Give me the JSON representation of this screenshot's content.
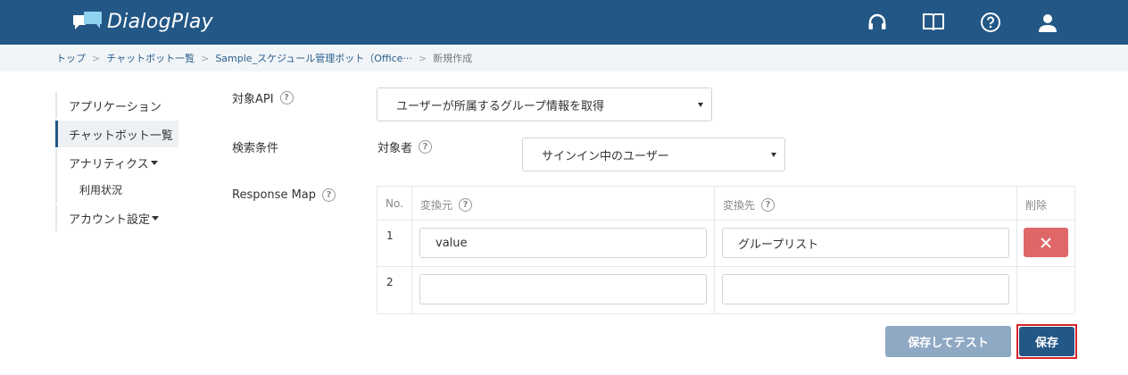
{
  "app": {
    "title": "DialogPlay"
  },
  "header": {
    "icons": [
      "headset-icon",
      "book-icon",
      "help-icon",
      "user-icon"
    ]
  },
  "breadcrumb": {
    "items": [
      "トップ",
      "チャットボット一覧",
      "Sample_スケジュール管理ボット（Office···"
    ],
    "current": "新規作成"
  },
  "sidenav": {
    "application": "アプリケーション",
    "chatbot_list": "チャットボット一覧",
    "analytics": "アナリティクス",
    "usage": "利用状況",
    "account": "アカウント設定"
  },
  "form": {
    "target_api_label": "対象API",
    "target_api_value": "ユーザーが所属するグループ情報を取得",
    "search_cond_label": "検索条件",
    "target_person_label": "対象者",
    "target_person_value": "サインイン中のユーザー",
    "response_map_label": "Response Map"
  },
  "response_table": {
    "headers": {
      "no": "No.",
      "from": "変換元",
      "to": "変換先",
      "delete": "削除"
    },
    "rows": [
      {
        "no": "1",
        "from": "value",
        "to": "グループリスト"
      },
      {
        "no": "2",
        "from": "",
        "to": ""
      }
    ]
  },
  "buttons": {
    "save_test": "保存してテスト",
    "save": "保存"
  },
  "colors": {
    "header_bg": "#235785",
    "delete_btn": "#e06767",
    "save_test_btn": "#8fa9c4",
    "save_btn": "#235785",
    "save_highlight": "#d6262b"
  }
}
